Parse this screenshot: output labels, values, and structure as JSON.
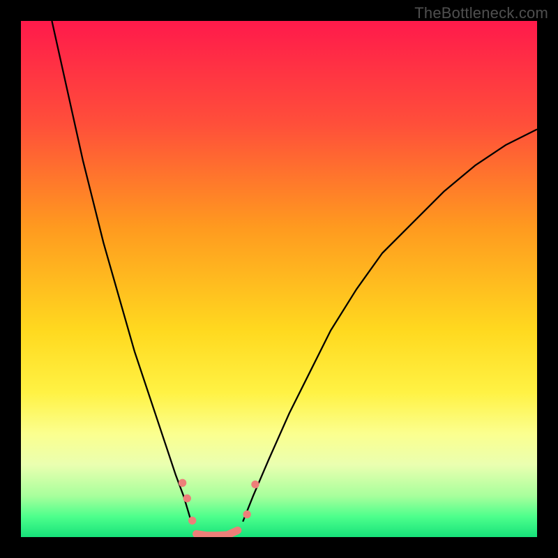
{
  "watermark": "TheBottleneck.com",
  "chart_data": {
    "type": "line",
    "title": "",
    "xlabel": "",
    "ylabel": "",
    "xlim": [
      0,
      100
    ],
    "ylim": [
      0,
      100
    ],
    "grid": false,
    "legend": false,
    "background_gradient_stops": [
      {
        "offset": 0.0,
        "color": "#ff1a4b"
      },
      {
        "offset": 0.2,
        "color": "#ff4f3a"
      },
      {
        "offset": 0.4,
        "color": "#ff9a1f"
      },
      {
        "offset": 0.6,
        "color": "#ffd91f"
      },
      {
        "offset": 0.72,
        "color": "#fff244"
      },
      {
        "offset": 0.8,
        "color": "#fbff8f"
      },
      {
        "offset": 0.86,
        "color": "#eaffb0"
      },
      {
        "offset": 0.92,
        "color": "#a8ff9c"
      },
      {
        "offset": 0.96,
        "color": "#4eff8c"
      },
      {
        "offset": 1.0,
        "color": "#16e27a"
      }
    ],
    "series": [
      {
        "name": "left-branch",
        "stroke": "#000000",
        "stroke_width": 2.3,
        "x": [
          6,
          8,
          10,
          12,
          14,
          16,
          18,
          20,
          22,
          24,
          26,
          28,
          30,
          31.5,
          33
        ],
        "y": [
          100,
          91,
          82,
          73,
          65,
          57,
          50,
          43,
          36,
          30,
          24,
          18,
          12,
          8,
          3
        ]
      },
      {
        "name": "right-branch",
        "stroke": "#000000",
        "stroke_width": 2.3,
        "x": [
          43,
          45,
          48,
          52,
          56,
          60,
          65,
          70,
          76,
          82,
          88,
          94,
          100
        ],
        "y": [
          3,
          8,
          15,
          24,
          32,
          40,
          48,
          55,
          61,
          67,
          72,
          76,
          79
        ]
      },
      {
        "name": "valley-marker-line",
        "stroke": "#ed7f79",
        "stroke_width": 11,
        "linecap": "round",
        "x": [
          34,
          36,
          38,
          40,
          42
        ],
        "y": [
          0.6,
          0.3,
          0.3,
          0.4,
          1.3
        ]
      }
    ],
    "points": [
      {
        "name": "left-dot-1",
        "x": 31.3,
        "y": 10.5,
        "r": 5.7,
        "color": "#ed7f79"
      },
      {
        "name": "left-dot-2",
        "x": 32.2,
        "y": 7.5,
        "r": 5.7,
        "color": "#ed7f79"
      },
      {
        "name": "left-dot-3",
        "x": 33.2,
        "y": 3.2,
        "r": 5.7,
        "color": "#ed7f79"
      },
      {
        "name": "right-dot-1",
        "x": 43.8,
        "y": 4.4,
        "r": 5.7,
        "color": "#ed7f79"
      },
      {
        "name": "right-dot-2",
        "x": 45.4,
        "y": 10.2,
        "r": 5.7,
        "color": "#ed7f79"
      }
    ]
  }
}
